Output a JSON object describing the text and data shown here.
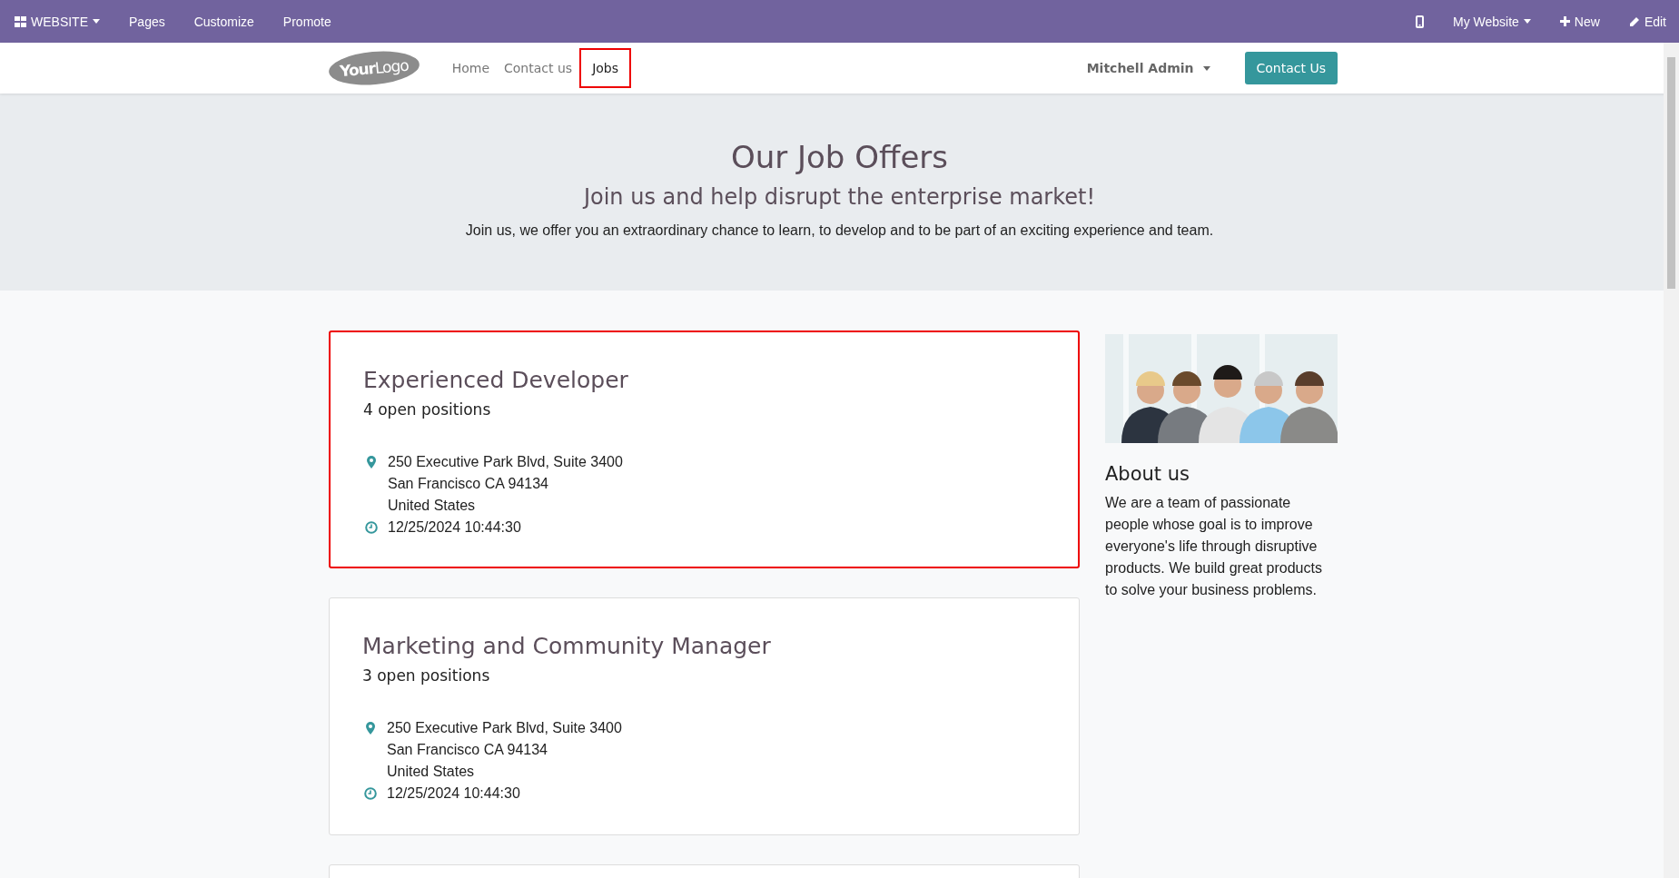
{
  "admin_bar": {
    "app_menu": "WEBSITE",
    "items": [
      "Pages",
      "Customize",
      "Promote"
    ],
    "site_menu": "My Website",
    "new": "New",
    "edit": "Edit"
  },
  "navbar": {
    "logo": "**Your**Logo",
    "links": [
      {
        "label": "Home",
        "selected": false,
        "highlighted": false
      },
      {
        "label": "Contact us",
        "selected": false,
        "highlighted": false
      },
      {
        "label": "Jobs",
        "selected": true,
        "highlighted": true
      }
    ],
    "user": "Mitchell Admin",
    "cta": "Contact Us"
  },
  "hero": {
    "title": "Our Job Offers",
    "subtitle": "Join us and help disrupt the enterprise market!",
    "text": "Join us, we offer you an extraordinary chance to learn, to develop and to be part of an exciting experience and team."
  },
  "jobs": [
    {
      "title": "Experienced Developer",
      "positions": "4 open positions",
      "address": [
        "250 Executive Park Blvd, Suite 3400",
        "San Francisco CA 94134",
        "United States"
      ],
      "date": "12/25/2024 10:44:30",
      "highlighted": true
    },
    {
      "title": "Marketing and Community Manager",
      "positions": "3 open positions",
      "address": [
        "250 Executive Park Blvd, Suite 3400",
        "San Francisco CA 94134",
        "United States"
      ],
      "date": "12/25/2024 10:44:30",
      "highlighted": false
    }
  ],
  "sidebar": {
    "title": "About us",
    "text": "We are a team of passionate people whose goal is to improve everyone's life through disruptive products. We build great products to solve your business problems."
  }
}
